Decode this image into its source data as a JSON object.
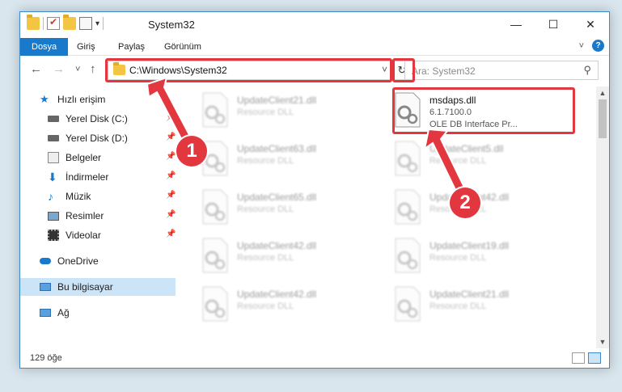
{
  "window": {
    "title": "System32",
    "controls": {
      "minimize": "—",
      "maximize": "☐",
      "close": "✕"
    }
  },
  "ribbon": {
    "tabs": [
      "Dosya",
      "Giriş",
      "Paylaş",
      "Görünüm"
    ],
    "active_tab": "Dosya",
    "accent": "#1979ca"
  },
  "navigation": {
    "back": "←",
    "forward": "→",
    "recent": "˅",
    "up": "↑",
    "address": "C:\\Windows\\System32",
    "search_placeholder": "Ara: System32"
  },
  "sidebar": {
    "items": [
      {
        "label": "Hızlı erişim",
        "icon": "star-icon",
        "pinned": false
      },
      {
        "label": "Yerel Disk (C:)",
        "icon": "drive-icon",
        "pinned": true
      },
      {
        "label": "Yerel Disk (D:)",
        "icon": "drive-icon",
        "pinned": true
      },
      {
        "label": "Belgeler",
        "icon": "document-icon",
        "pinned": true
      },
      {
        "label": "İndirmeler",
        "icon": "download-icon",
        "pinned": true
      },
      {
        "label": "Müzik",
        "icon": "music-icon",
        "pinned": true
      },
      {
        "label": "Resimler",
        "icon": "picture-icon",
        "pinned": true
      },
      {
        "label": "Videolar",
        "icon": "video-icon",
        "pinned": true
      },
      {
        "label": "OneDrive",
        "icon": "cloud-icon",
        "pinned": false
      },
      {
        "label": "Bu bilgisayar",
        "icon": "computer-icon",
        "pinned": false,
        "selected": true
      },
      {
        "label": "Ağ",
        "icon": "network-icon",
        "pinned": false
      }
    ]
  },
  "files": [
    {
      "name": "UpdateClient21.dll",
      "desc": "Resource DLL"
    },
    {
      "name": "msdaps.dll",
      "version": "6.1.7100.0",
      "desc": "OLE DB Interface Pr...",
      "selected": true
    },
    {
      "name": "UpdateClient63.dll",
      "desc": "Resource DLL"
    },
    {
      "name": "UpdateClient5.dll",
      "desc": "Resource DLL"
    },
    {
      "name": "UpdateClient65.dll",
      "desc": "Resource DLL"
    },
    {
      "name": "UpdateClient42.dll",
      "desc": "Resource DLL"
    },
    {
      "name": "UpdateClient42.dll",
      "desc": "Resource DLL"
    },
    {
      "name": "UpdateClient19.dll",
      "desc": "Resource DLL"
    },
    {
      "name": "UpdateClient42.dll",
      "desc": "Resource DLL"
    },
    {
      "name": "UpdateClient21.dll",
      "desc": "Resource DLL"
    }
  ],
  "status": {
    "item_count": "129 öğe"
  },
  "annotations": {
    "marker1": "1",
    "marker2": "2",
    "color": "#e2373e"
  }
}
